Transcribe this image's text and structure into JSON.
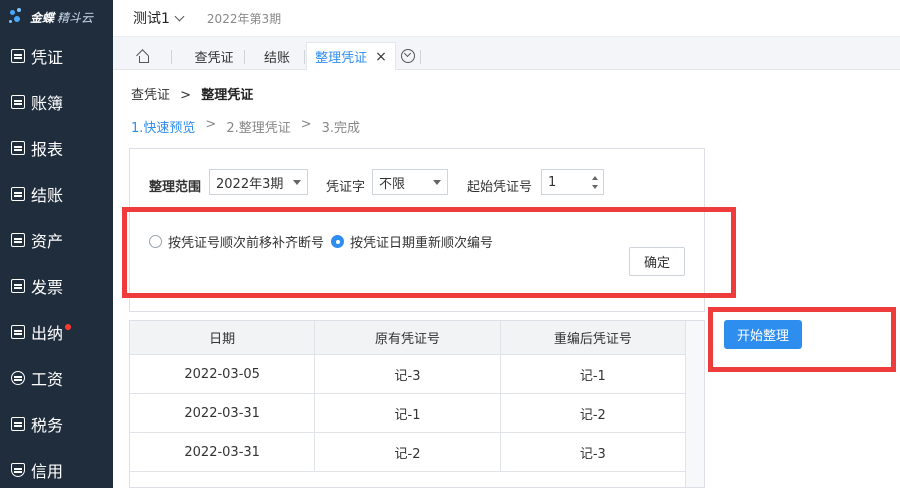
{
  "logo": {
    "brand": "金蝶",
    "product": "精斗云"
  },
  "sidebar": {
    "items": [
      {
        "label": "凭证",
        "icon": "voucher-icon"
      },
      {
        "label": "账簿",
        "icon": "ledger-icon"
      },
      {
        "label": "报表",
        "icon": "report-icon"
      },
      {
        "label": "结账",
        "icon": "closing-icon"
      },
      {
        "label": "资产",
        "icon": "asset-icon"
      },
      {
        "label": "发票",
        "icon": "invoice-icon"
      },
      {
        "label": "出纳",
        "icon": "cashier-icon"
      },
      {
        "label": "工资",
        "icon": "salary-icon"
      },
      {
        "label": "税务",
        "icon": "tax-icon"
      },
      {
        "label": "信用",
        "icon": "credit-icon"
      }
    ]
  },
  "header": {
    "account": "测试1",
    "period": "2022年第3期"
  },
  "tabs": [
    {
      "label": "查凭证"
    },
    {
      "label": "结账"
    },
    {
      "label": "整理凭证",
      "active": true,
      "close": "×"
    }
  ],
  "breadcrumb": {
    "parent": "查凭证",
    "sep": ">",
    "current": "整理凭证"
  },
  "steps": {
    "s1": "1.快速预览",
    "sep": ">",
    "s2": "2.整理凭证",
    "s3": "3.完成"
  },
  "form": {
    "range_label": "整理范围",
    "range_value": "2022年3期",
    "word_label": "凭证字",
    "word_value": "不限",
    "start_label": "起始凭证号",
    "start_value": "1",
    "radio1": "按凭证号顺次前移补齐断号",
    "radio2": "按凭证日期重新顺次编号",
    "selected_radio": 2,
    "confirm": "确定"
  },
  "start_button": "开始整理",
  "table": {
    "headers": [
      "日期",
      "原有凭证号",
      "重编后凭证号"
    ],
    "rows": [
      [
        "2022-03-05",
        "记-3",
        "记-1"
      ],
      [
        "2022-03-31",
        "记-1",
        "记-2"
      ],
      [
        "2022-03-31",
        "记-2",
        "记-3"
      ]
    ]
  },
  "colors": {
    "sidebar": "#1f2d3d",
    "accent": "#2e8ef0",
    "highlight": "#ee3b3b"
  }
}
